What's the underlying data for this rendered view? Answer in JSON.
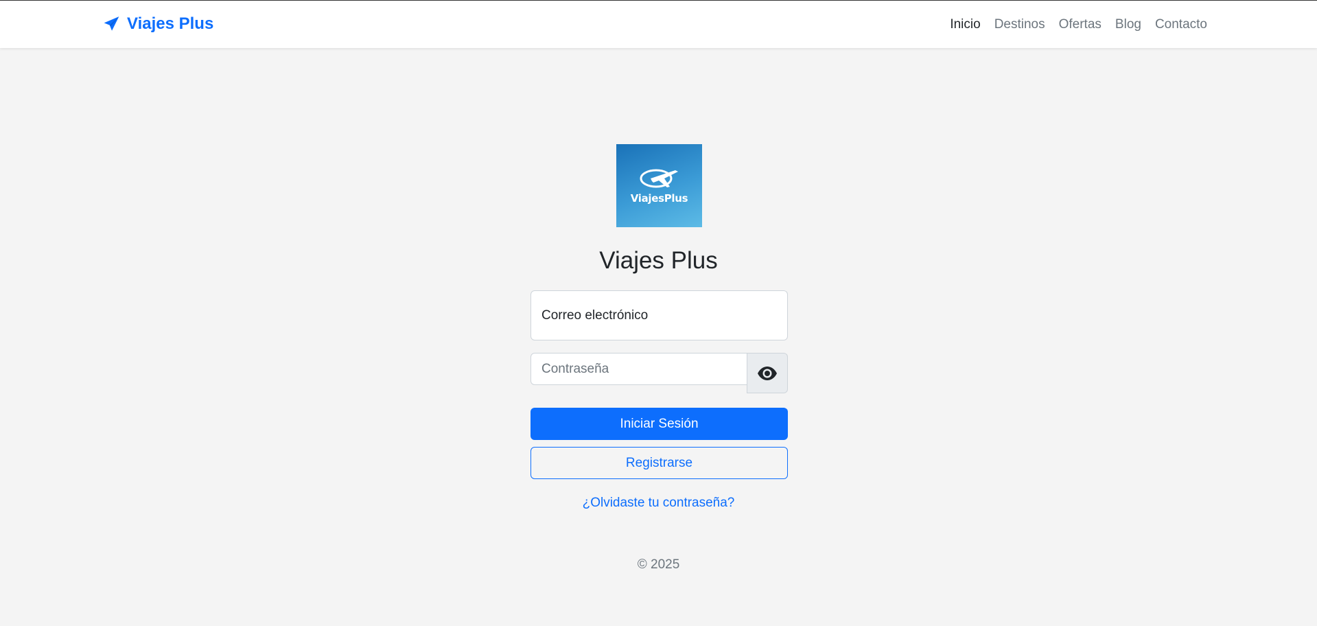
{
  "navbar": {
    "brand": "Viajes Plus",
    "brand_icon": "paper-plane-icon",
    "links": [
      "Inicio",
      "Destinos",
      "Ofertas",
      "Blog",
      "Contacto"
    ],
    "active": "Inicio"
  },
  "logo": {
    "text": "ViajesPlus",
    "icon": "airplane-icon"
  },
  "login": {
    "title": "Viajes Plus",
    "email_value": "Correo electrónico",
    "password_placeholder": "Contraseña",
    "toggle_icon": "eye-icon",
    "submit_label": "Iniciar Sesión",
    "register_label": "Registrarse",
    "forgot_label": "¿Olvidaste tu contraseña?"
  },
  "footer": {
    "text": "© 2025"
  },
  "colors": {
    "primary": "#0d6efd",
    "background": "#f4f4f4"
  }
}
